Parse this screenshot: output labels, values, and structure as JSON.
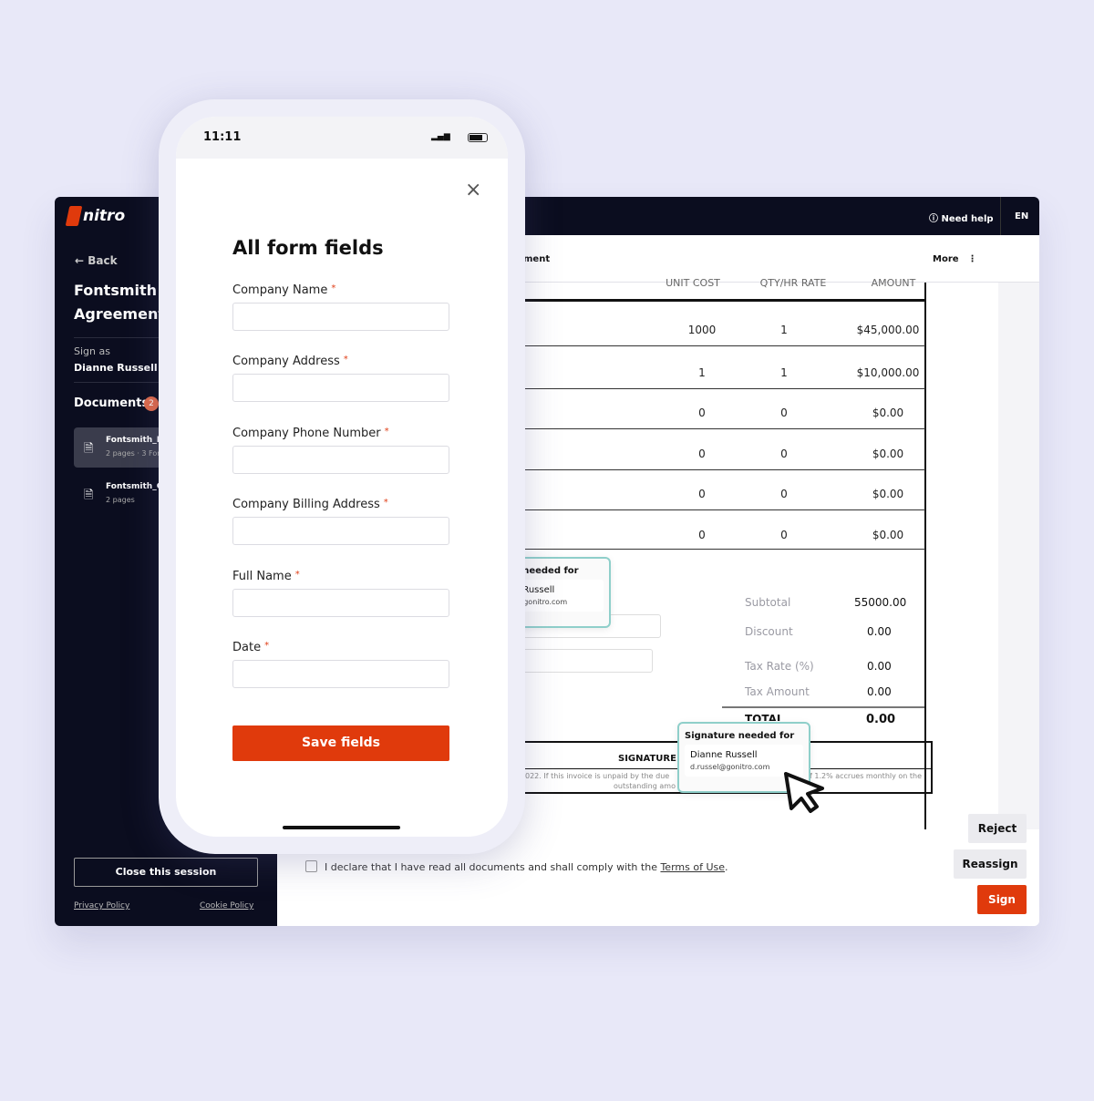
{
  "app": {
    "brand": "nitro",
    "back": "Back",
    "doc_title": "Fontsmith E Agreement",
    "sign_as_label": "Sign as",
    "signer": "Dianne Russell",
    "documents_label": "Documents",
    "documents_count": "2",
    "documents": [
      {
        "name": "Fontsmith_E",
        "meta": "2 pages · 3 For"
      },
      {
        "name": "Fontsmith_C",
        "meta": "2 pages"
      }
    ],
    "close_session": "Close this session",
    "privacy": "Privacy Policy",
    "cookie": "Cookie Policy",
    "need_help": "Need help",
    "lang": "EN",
    "toolbar_title": "ment",
    "more": "More",
    "accent": "#e03a0c"
  },
  "invoice": {
    "headers": [
      "UNIT COST",
      "QTY/HR RATE",
      "AMOUNT"
    ],
    "rows": [
      [
        "1000",
        "1",
        "$45,000.00"
      ],
      [
        "1",
        "1",
        "$10,000.00"
      ],
      [
        "0",
        "0",
        "$0.00"
      ],
      [
        "0",
        "0",
        "$0.00"
      ],
      [
        "0",
        "0",
        "$0.00"
      ],
      [
        "0",
        "0",
        "$0.00"
      ]
    ],
    "subtotal_label": "Subtotal",
    "subtotal": "55000.00",
    "discount_label": "Discount",
    "discount": "0.00",
    "taxrate_label": "Tax Rate (%)",
    "taxrate": "0.00",
    "taxamount_label": "Tax Amount",
    "taxamount": "0.00",
    "total_label": "TOTAL",
    "total": "0.00",
    "signature_label": "SIGNATURE:",
    "footnote_left": "022. If this invoice is unpaid by the due",
    "footnote_left2": "outstanding amo",
    "footnote_right": "f 1.2% accrues monthly on the",
    "sig_box1": {
      "title": "re needed for",
      "name": "e Russell",
      "email": "l@gonitro.com"
    },
    "sig_box2": {
      "title": "Signature needed for",
      "name": "Dianne Russell",
      "email": "d.russel@gonitro.com"
    }
  },
  "footer": {
    "declare": "I declare that I have read all documents and shall comply with the ",
    "terms": "Terms of Use",
    "period": ".",
    "reject": "Reject",
    "reassign": "Reassign",
    "sign": "Sign"
  },
  "phone": {
    "time": "11:11",
    "title": "All form fields",
    "fields": [
      "Company Name",
      "Company Address",
      "Company Phone Number",
      "Company Billing Address",
      "Full Name",
      "Date"
    ],
    "required": "*",
    "save": "Save fields"
  }
}
